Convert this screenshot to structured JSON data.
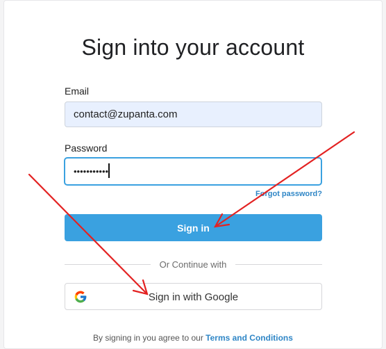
{
  "form": {
    "title": "Sign into your account",
    "email_label": "Email",
    "email_value": "contact@zupanta.com",
    "password_label": "Password",
    "password_masked": "•••••••••••",
    "forgot_label": "Forgot password?",
    "signin_label": "Sign in",
    "divider_text": "Or Continue with",
    "google_label": "Sign in with Google",
    "legal_prefix": "By signing in you agree to our",
    "legal_link": "Terms and Conditions"
  },
  "icons": {
    "google": "google-icon"
  },
  "colors": {
    "primary": "#3aa1e0",
    "link": "#2f86c6",
    "email_bg": "#e8f0fe",
    "annotation": "#e32222"
  }
}
